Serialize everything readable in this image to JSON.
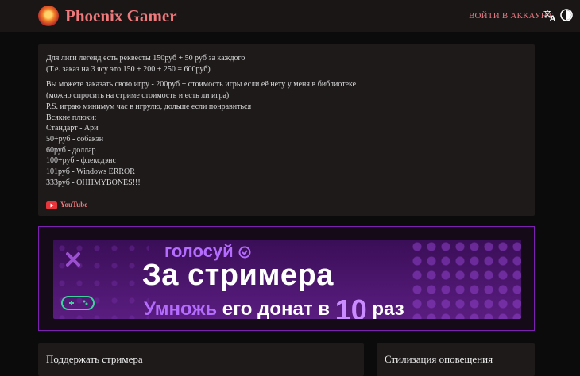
{
  "header": {
    "brand": "Phoenix Gamer",
    "login_label": "ВОЙТИ В АККАУНТ",
    "icons": [
      "phoenix-logo-icon",
      "translate-icon",
      "theme-toggle-icon"
    ]
  },
  "description": {
    "paragraph1": "Для лиги легенд есть реквесты 150руб + 50 руб за каждого\n(Т.е. заказ на 3 ясу это 150 + 200 + 250 = 600руб)",
    "paragraph2": "Вы можете заказать свою игру - 200руб + стоимость игры если её нету у меня в библиотеке\n(можно спросить на стриме стоимость и есть ли игра)\nP.S. играю минимум час в игрулю, дольше если понравиться\nВсякие плюхи:\nСтандарт - Ари\n50+руб - собакэн\n60руб - доллар\n100+руб - флексдэнс\n101руб - Windows ERROR\n333руб - OHHMYBONES!!!",
    "youtube_label": "YouTube"
  },
  "banner": {
    "line1": "голосуй",
    "line2": "За стримера",
    "line3_accent": "Умножь",
    "line3_rest": " его донат в ",
    "line3_number": "10",
    "line3_end": " раз"
  },
  "support_title": "Поддержать стримера",
  "alerts_title": "Стилизация оповещения",
  "colors": {
    "accent": "#f0797c",
    "background": "#0b0b0b",
    "card": "#1e1a1a",
    "banner_purple": "#5a1d80"
  }
}
